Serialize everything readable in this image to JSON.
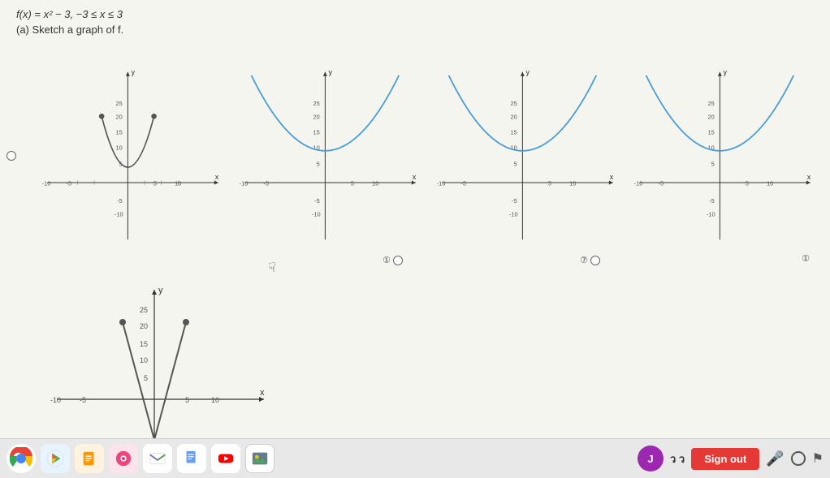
{
  "equation": {
    "text": "f(x) = x² − 3,   −3 ≤ x ≤ 3"
  },
  "instruction": "(a)  Sketch a graph of f.",
  "graphs": [
    {
      "id": "graph1",
      "type": "parabola_partial",
      "has_radio": false,
      "radio_selected": false
    },
    {
      "id": "graph2",
      "type": "parabola_full_blue",
      "has_radio": true,
      "radio_label": "①○"
    },
    {
      "id": "graph3",
      "type": "parabola_full_blue2",
      "has_radio": true,
      "radio_label": "⑦○"
    },
    {
      "id": "graph4",
      "type": "parabola_full_blue3",
      "has_radio": true,
      "radio_label": "①"
    }
  ],
  "bottom_graphs": [
    {
      "id": "graph5",
      "type": "parabola_bottom"
    }
  ],
  "left_radio": {
    "label": "○"
  },
  "taskbar": {
    "icons": [
      "chrome",
      "store",
      "files",
      "music",
      "gmail",
      "docs",
      "play",
      "photos"
    ],
    "right": {
      "text": "ว ว",
      "sign_out": "Sign out",
      "mic": "🎤",
      "circle": "○",
      "flag": "⚑"
    }
  }
}
